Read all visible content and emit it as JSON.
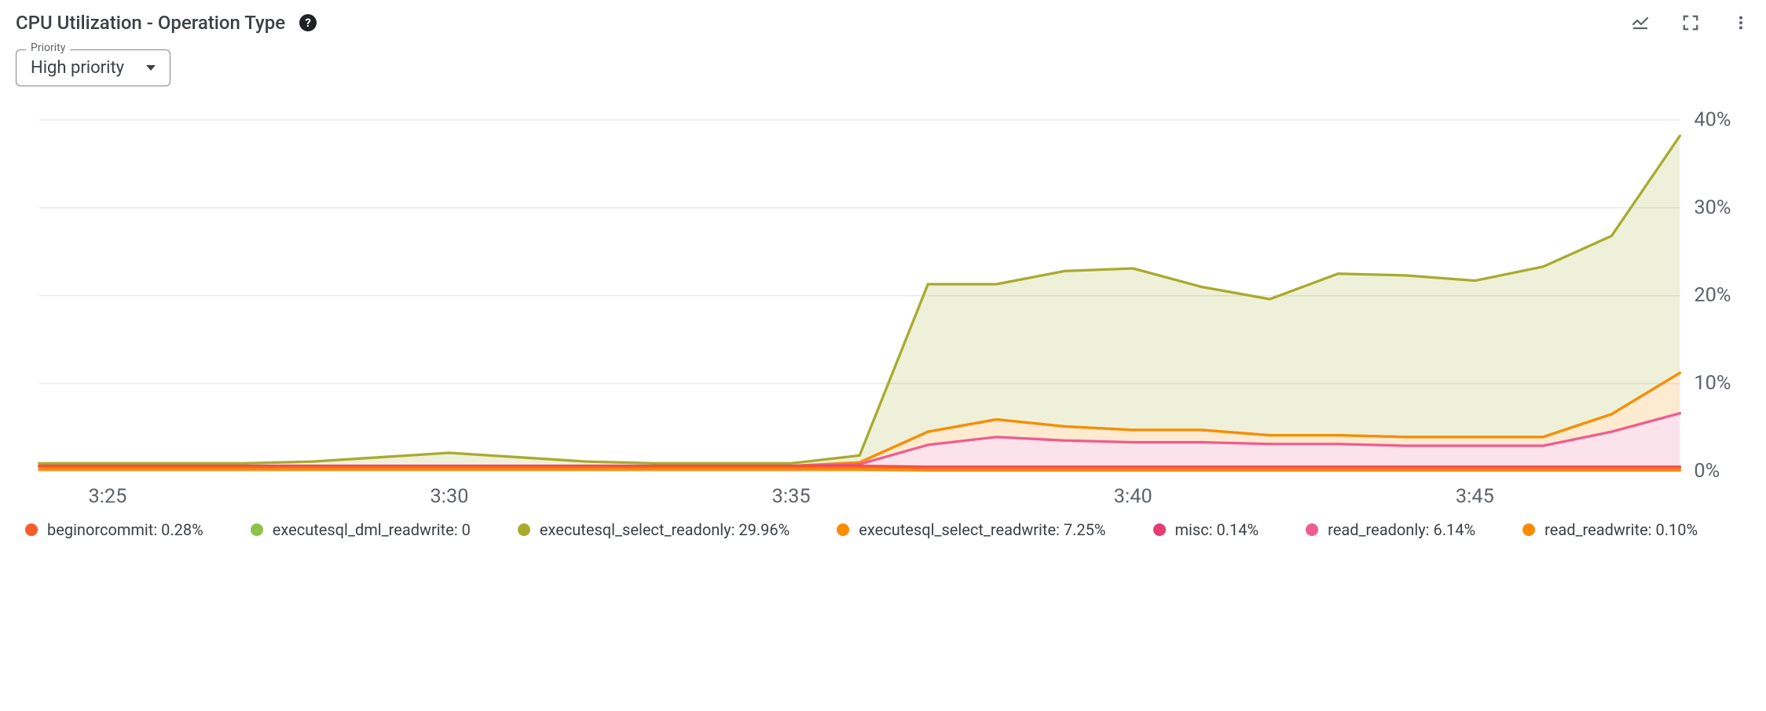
{
  "header": {
    "title": "CPU Utilization - Operation Type"
  },
  "dropdown": {
    "label": "Priority",
    "value": "High priority"
  },
  "legend": [
    {
      "name": "beginorcommit",
      "value": "0.28%",
      "color": "#fa5b2a"
    },
    {
      "name": "executesql_dml_readwrite",
      "value": "0",
      "color": "#8bc34a"
    },
    {
      "name": "executesql_select_readonly",
      "value": "29.96%",
      "color": "#a8ab2c"
    },
    {
      "name": "executesql_select_readwrite",
      "value": "7.25%",
      "color": "#fb8c00"
    },
    {
      "name": "misc",
      "value": "0.14%",
      "color": "#e53d72"
    },
    {
      "name": "read_readonly",
      "value": "6.14%",
      "color": "#ef5d8f"
    },
    {
      "name": "read_readwrite",
      "value": "0.10%",
      "color": "#fb8c00"
    }
  ],
  "chart_data": {
    "type": "area",
    "title": "CPU Utilization - Operation Type",
    "xlabel": "",
    "ylabel": "",
    "ylim": [
      0,
      40
    ],
    "yticks": [
      0,
      10,
      20,
      30,
      40
    ],
    "x": [
      "3:24",
      "3:25",
      "3:26",
      "3:27",
      "3:28",
      "3:29",
      "3:30",
      "3:31",
      "3:32",
      "3:33",
      "3:34",
      "3:35",
      "3:36",
      "3:37",
      "3:38",
      "3:39",
      "3:40",
      "3:41",
      "3:42",
      "3:43",
      "3:44",
      "3:45",
      "3:46",
      "3:47",
      "3:48"
    ],
    "xticks": [
      "3:25",
      "3:30",
      "3:35",
      "3:40",
      "3:45"
    ],
    "series": [
      {
        "name": "read_readwrite",
        "color": "#fb8c00",
        "values": [
          0.2,
          0.2,
          0.2,
          0.2,
          0.2,
          0.2,
          0.2,
          0.2,
          0.2,
          0.2,
          0.2,
          0.2,
          0.2,
          0.1,
          0.1,
          0.1,
          0.1,
          0.1,
          0.1,
          0.1,
          0.1,
          0.1,
          0.1,
          0.1,
          0.1
        ]
      },
      {
        "name": "beginorcommit",
        "color": "#fa5b2a",
        "values": [
          0.3,
          0.3,
          0.3,
          0.3,
          0.3,
          0.3,
          0.3,
          0.3,
          0.3,
          0.3,
          0.3,
          0.3,
          0.3,
          0.3,
          0.3,
          0.3,
          0.3,
          0.3,
          0.3,
          0.3,
          0.3,
          0.3,
          0.3,
          0.3,
          0.3
        ]
      },
      {
        "name": "misc",
        "color": "#e53d72",
        "values": [
          0.1,
          0.1,
          0.1,
          0.1,
          0.1,
          0.1,
          0.1,
          0.1,
          0.1,
          0.1,
          0.1,
          0.1,
          0.1,
          0.1,
          0.1,
          0.1,
          0.1,
          0.1,
          0.1,
          0.1,
          0.1,
          0.1,
          0.1,
          0.1,
          0.1
        ]
      },
      {
        "name": "read_readonly",
        "color": "#ef5d8f",
        "values": [
          0,
          0,
          0,
          0,
          0,
          0,
          0,
          0,
          0,
          0,
          0,
          0,
          0.2,
          2.5,
          3.4,
          3.0,
          2.8,
          2.8,
          2.6,
          2.6,
          2.4,
          2.4,
          2.4,
          4.0,
          6.1
        ]
      },
      {
        "name": "executesql_select_readwrite",
        "color": "#fb8c00",
        "values": [
          0,
          0,
          0,
          0,
          0,
          0,
          0,
          0,
          0,
          0,
          0,
          0,
          0.2,
          1.5,
          2.0,
          1.6,
          1.4,
          1.4,
          1.0,
          1.0,
          1.0,
          1.0,
          1.0,
          2.0,
          4.6
        ]
      },
      {
        "name": "executesql_dml_readwrite",
        "color": "#8bc34a",
        "values": [
          0,
          0,
          0,
          0,
          0,
          0,
          0,
          0,
          0,
          0,
          0,
          0,
          0,
          0,
          0,
          0,
          0,
          0,
          0,
          0,
          0,
          0,
          0,
          0,
          0
        ]
      },
      {
        "name": "executesql_select_readonly",
        "color": "#a8ab2c",
        "values": [
          0.3,
          0.3,
          0.3,
          0.3,
          0.5,
          1.0,
          1.5,
          1.0,
          0.5,
          0.3,
          0.3,
          0.3,
          0.8,
          16.8,
          15.4,
          17.7,
          18.4,
          16.3,
          15.5,
          18.4,
          18.4,
          17.8,
          19.4,
          20.3,
          27.0
        ]
      }
    ]
  }
}
